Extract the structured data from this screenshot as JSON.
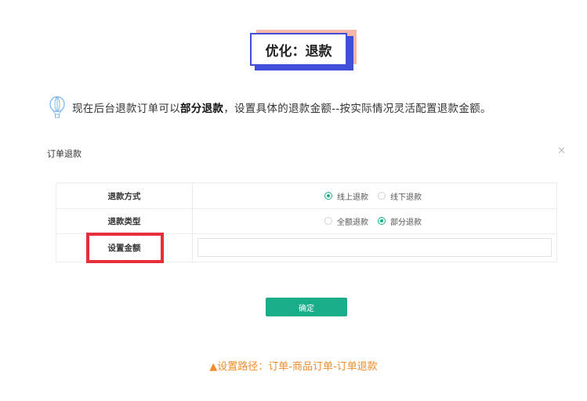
{
  "header": {
    "title": "优化：退款"
  },
  "description": {
    "icon": "balloon-icon",
    "text_before": "现在后台退款订单可以",
    "text_bold": "部分退款",
    "text_after": "，设置具体的退款金额--按实际情况灵活配置退款金额。"
  },
  "modal": {
    "title": "订单退款",
    "close_label": "×",
    "rows": [
      {
        "label": "退款方式",
        "options": [
          {
            "label": "线上退款",
            "selected": true
          },
          {
            "label": "线下退款",
            "selected": false
          }
        ]
      },
      {
        "label": "退款类型",
        "options": [
          {
            "label": "全额退款",
            "selected": false
          },
          {
            "label": "部分退款",
            "selected": true
          }
        ]
      },
      {
        "label": "设置金额",
        "value": ""
      }
    ],
    "confirm_label": "确定"
  },
  "footer": {
    "path": "▲设置路径：订单-商品订单-订单退款"
  },
  "colors": {
    "accent_green": "#1aad8a",
    "highlight_red": "#e5303a",
    "title_blue": "#3f4fd8",
    "title_pink": "#f7b7a6",
    "path_orange": "#f08d2b"
  }
}
